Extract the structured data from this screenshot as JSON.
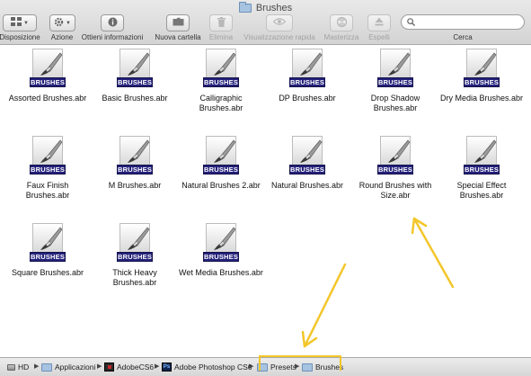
{
  "window": {
    "title": "Brushes"
  },
  "toolbar": {
    "items": [
      {
        "label": "Disposizione",
        "icon": "grid-view-icon",
        "enabled": true
      },
      {
        "label": "Azione",
        "icon": "gear-icon",
        "enabled": true
      },
      {
        "label": "Ottieni informazioni",
        "icon": "info-icon",
        "enabled": true
      },
      {
        "label": "Nuova cartella",
        "icon": "new-folder-icon",
        "enabled": true
      },
      {
        "label": "Elimina",
        "icon": "trash-icon",
        "enabled": false
      },
      {
        "label": "Visualizzazione rapida",
        "icon": "eye-icon",
        "enabled": false
      },
      {
        "label": "Masterizza",
        "icon": "burn-icon",
        "enabled": false
      },
      {
        "label": "Espelli",
        "icon": "eject-icon",
        "enabled": false
      }
    ],
    "search": {
      "label": "Cerca",
      "value": "",
      "placeholder": ""
    }
  },
  "files": {
    "badge_text": "BRUSHES",
    "items": [
      {
        "name": "Assorted Brushes.abr"
      },
      {
        "name": "Basic Brushes.abr"
      },
      {
        "name": "Calligraphic Brushes.abr"
      },
      {
        "name": "DP Brushes.abr"
      },
      {
        "name": "Drop Shadow Brushes.abr"
      },
      {
        "name": "Dry Media Brushes.abr"
      },
      {
        "name": "Faux Finish Brushes.abr"
      },
      {
        "name": "M Brushes.abr"
      },
      {
        "name": "Natural Brushes 2.abr"
      },
      {
        "name": "Natural Brushes.abr"
      },
      {
        "name": "Round Brushes with Size.abr"
      },
      {
        "name": "Special Effect Brushes.abr"
      },
      {
        "name": "Square Brushes.abr"
      },
      {
        "name": "Thick Heavy Brushes.abr"
      },
      {
        "name": "Wet Media Brushes.abr"
      }
    ]
  },
  "pathbar": {
    "crumbs": [
      {
        "label": "HD",
        "icon": "hard-drive-icon"
      },
      {
        "label": "Applicazioni",
        "icon": "folder-icon"
      },
      {
        "label": "AdobeCS6",
        "icon": "adobe-folder-icon"
      },
      {
        "label": "Adobe Photoshop CS6",
        "icon": "photoshop-folder-icon"
      },
      {
        "label": "Presets",
        "icon": "folder-icon"
      },
      {
        "label": "Brushes",
        "icon": "folder-icon"
      }
    ]
  },
  "colors": {
    "annotation": "#f3c62a",
    "badge": "#24217a",
    "folder": "#a7c3e2"
  }
}
